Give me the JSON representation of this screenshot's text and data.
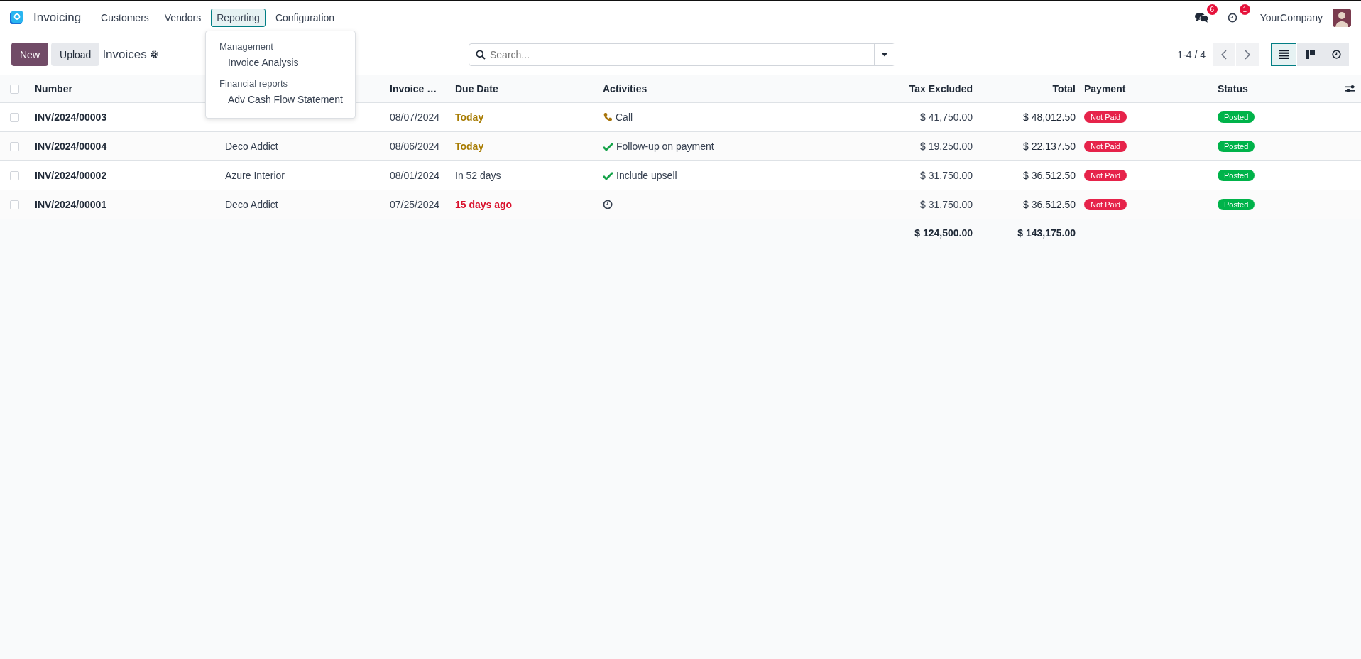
{
  "navbar": {
    "app_name": "Invoicing",
    "menus": [
      {
        "label": "Customers",
        "selected": false
      },
      {
        "label": "Vendors",
        "selected": false
      },
      {
        "label": "Reporting",
        "selected": true
      },
      {
        "label": "Configuration",
        "selected": false
      }
    ],
    "messages_badge": "6",
    "activities_badge": "1",
    "company": "YourCompany"
  },
  "reporting_menu": {
    "sections": [
      {
        "header": "Management",
        "items": [
          "Invoice Analysis"
        ]
      },
      {
        "header": "Financial reports",
        "items": [
          "Adv Cash Flow Statement"
        ]
      }
    ]
  },
  "control_panel": {
    "buttons": [
      "New",
      "Upload"
    ],
    "title": "Invoices",
    "search": {
      "placeholder": "Search..."
    },
    "pager": "1-4 / 4",
    "views": [
      {
        "kind": "list",
        "selected": true
      },
      {
        "kind": "kanban",
        "selected": false
      },
      {
        "kind": "activity",
        "selected": false
      }
    ]
  },
  "table": {
    "select_all": {
      "checked": false
    },
    "columns": {
      "number": "Number",
      "invoice_date": "Invoice …",
      "due_date": "Due Date",
      "activities": "Activities",
      "tax_excluded": "Tax Excluded",
      "total": "Total",
      "payment": "Payment",
      "status": "Status"
    },
    "rows": [
      {
        "checked": false,
        "number": "INV/2024/00003",
        "invoice_date": "08/07/2024",
        "due_date": {
          "text": "Today",
          "kind": "today"
        },
        "activity": {
          "kind": "phone",
          "text": "Call"
        },
        "tax_excluded": "$ 41,750.00",
        "total": "$ 48,012.50",
        "payment": "Not Paid",
        "status": "Posted"
      },
      {
        "checked": false,
        "number": "INV/2024/00004",
        "customer": "Deco Addict",
        "invoice_date": "08/06/2024",
        "due_date": {
          "text": "Today",
          "kind": "today"
        },
        "activity": {
          "kind": "done",
          "text": "Follow-up on payment"
        },
        "tax_excluded": "$ 19,250.00",
        "total": "$ 22,137.50",
        "payment": "Not Paid",
        "status": "Posted"
      },
      {
        "checked": false,
        "number": "INV/2024/00002",
        "customer": "Azure Interior",
        "invoice_date": "08/01/2024",
        "due_date": {
          "text": "In 52 days",
          "kind": "future"
        },
        "activity": {
          "kind": "done",
          "text": "Include upsell"
        },
        "tax_excluded": "$ 31,750.00",
        "total": "$ 36,512.50",
        "payment": "Not Paid",
        "status": "Posted"
      },
      {
        "checked": false,
        "number": "INV/2024/00001",
        "customer": "Deco Addict",
        "invoice_date": "07/25/2024",
        "due_date": {
          "text": "15 days ago",
          "kind": "overdue"
        },
        "activity": {
          "kind": "clock"
        },
        "tax_excluded": "$ 31,750.00",
        "total": "$ 36,512.50",
        "payment": "Not Paid",
        "status": "Posted"
      }
    ],
    "totals": {
      "tax_excluded": "$ 124,500.00",
      "total": "$ 143,175.00"
    }
  }
}
